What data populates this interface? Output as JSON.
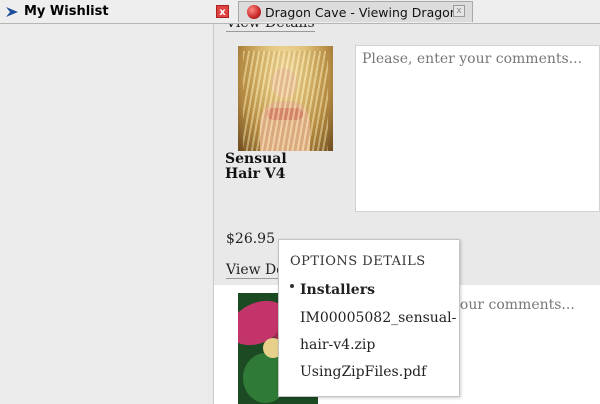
{
  "tabs": {
    "left_title": "My Wishlist",
    "left_close": "x",
    "right_title": "Dragon Cave - Viewing Dragons",
    "right_close": "x"
  },
  "product1": {
    "view_details_top": "View Details",
    "title_line1": "Sensual",
    "title_line2": "Hair V4",
    "comment_placeholder": "Please, enter your comments...",
    "price": "$26.95",
    "view_details": "View De"
  },
  "product2": {
    "comment_placeholder": "your comments..."
  },
  "options": {
    "heading": "OPTIONS DETAILS",
    "installers_label": "Installers",
    "files": [
      "IM00005082_sensual-",
      "hair-v4.zip",
      "UsingZipFiles.pdf"
    ]
  }
}
